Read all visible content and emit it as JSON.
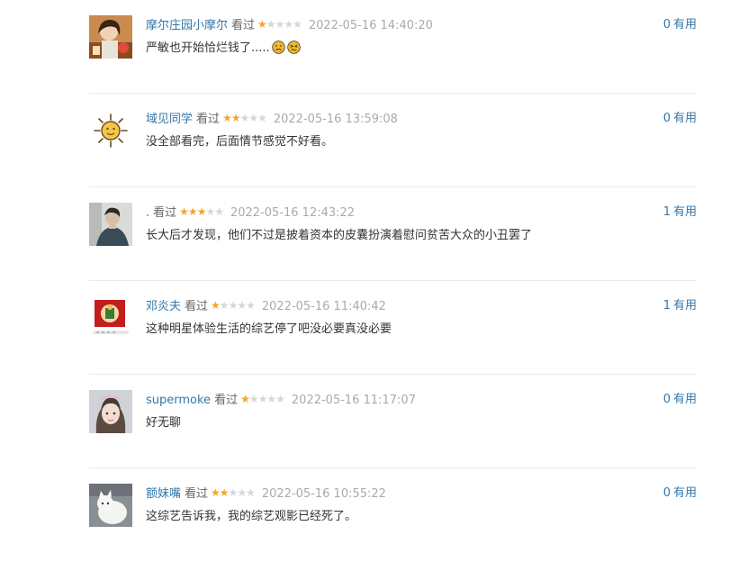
{
  "comments": [
    {
      "user": "摩尔庄园小摩尔",
      "watched": "看过",
      "rating": 1,
      "time": "2022-05-16 14:40:20",
      "text": "严敏也开始恰烂钱了.....",
      "emojis": [
        "frowning-face",
        "persevering-face"
      ],
      "votes": "0",
      "vote_label": "有用",
      "avatar": "girl-eating-photo"
    },
    {
      "user": "域见同学",
      "watched": "看过",
      "rating": 2,
      "time": "2022-05-16 13:59:08",
      "text": "没全部看完，后面情节感觉不好看。",
      "emojis": [],
      "votes": "0",
      "vote_label": "有用",
      "avatar": "sun-drawing"
    },
    {
      "user": ".",
      "watched": "看过",
      "rating": 3,
      "time": "2022-05-16 12:43:22",
      "text": "长大后才发现，他们不过是披着资本的皮囊扮演着慰问贫苦大众的小丑罢了",
      "emojis": [],
      "votes": "1",
      "vote_label": "有用",
      "avatar": "man-portrait-photo"
    },
    {
      "user": "邓炎夫",
      "watched": "看过",
      "rating": 1,
      "time": "2022-05-16 11:40:42",
      "text": "这种明星体验生活的综艺停了吧没必要真没必要",
      "emojis": [],
      "votes": "1",
      "vote_label": "有用",
      "avatar": "red-card-image"
    },
    {
      "user": "supermoke",
      "watched": "看过",
      "rating": 1,
      "time": "2022-05-16 11:17:07",
      "text": "好无聊",
      "emojis": [],
      "votes": "0",
      "vote_label": "有用",
      "avatar": "girl-portrait-photo"
    },
    {
      "user": "额妹嘴",
      "watched": "看过",
      "rating": 2,
      "time": "2022-05-16 10:55:22",
      "text": "这综艺告诉我，我的综艺观影已经死了。",
      "emojis": [],
      "votes": "0",
      "vote_label": "有用",
      "avatar": "white-cat-photo"
    }
  ],
  "colors": {
    "link": "#3377aa",
    "star_on": "#f5a623",
    "star_off": "#d6d6d6",
    "time": "#aaaaaa",
    "divider": "#eaeaea"
  }
}
